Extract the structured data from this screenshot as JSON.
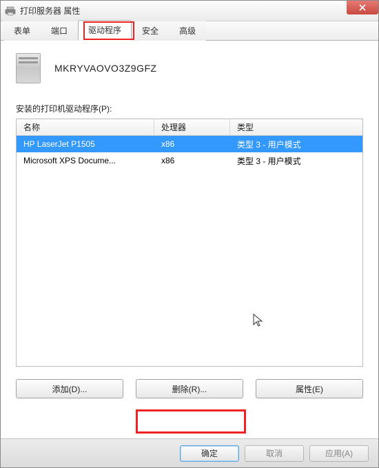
{
  "window": {
    "title": "打印服务器 属性"
  },
  "tabs": [
    {
      "label": "表单"
    },
    {
      "label": "端口"
    },
    {
      "label": "驱动程序",
      "active": true
    },
    {
      "label": "安全"
    },
    {
      "label": "高级"
    }
  ],
  "server": {
    "name": "MKRYVAOVO3Z9GFZ"
  },
  "section": {
    "drivers_label": "安装的打印机驱动程序(P):"
  },
  "columns": {
    "name": "名称",
    "processor": "处理器",
    "type": "类型"
  },
  "drivers": [
    {
      "name": "HP LaserJet P1505",
      "processor": "x86",
      "type": "类型 3 - 用户模式",
      "selected": true
    },
    {
      "name": "Microsoft XPS Docume...",
      "processor": "x86",
      "type": "类型 3 - 用户模式",
      "selected": false
    }
  ],
  "buttons": {
    "add": "添加(D)...",
    "remove": "删除(R)...",
    "properties": "属性(E)"
  },
  "footer": {
    "ok": "确定",
    "cancel": "取消",
    "apply": "应用(A)"
  }
}
